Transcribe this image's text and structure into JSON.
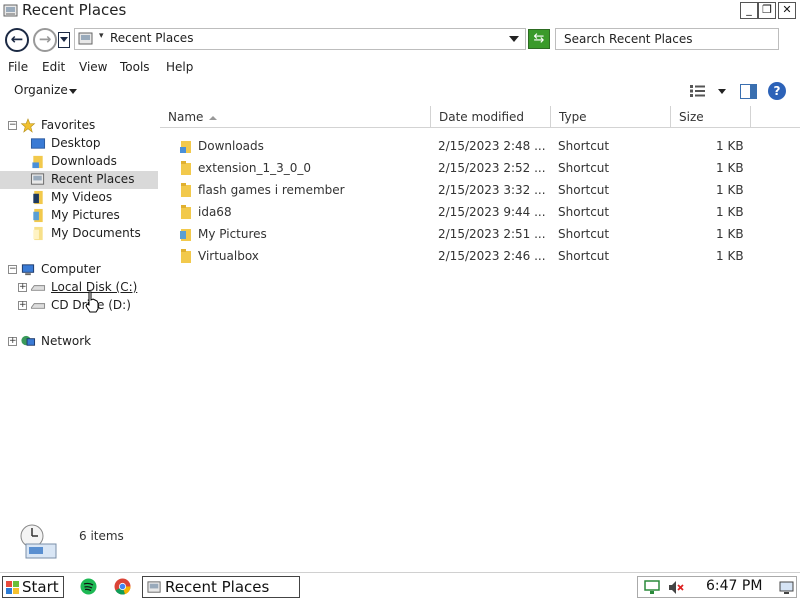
{
  "window": {
    "title": "Recent Places",
    "controls": {
      "minimize": "_",
      "maximize": "❐",
      "close": "✕"
    }
  },
  "address": {
    "separator": "▾",
    "location": "Recent Places",
    "search_placeholder": "Search Recent Places"
  },
  "menu": [
    "File",
    "Edit",
    "View",
    "Tools",
    "Help"
  ],
  "toolbar": {
    "organize": "Organize",
    "help": "?"
  },
  "navigation": {
    "favorites": {
      "label": "Favorites",
      "items": [
        "Desktop",
        "Downloads",
        "Recent Places",
        "My Videos",
        "My Pictures",
        "My Documents"
      ],
      "selected": "Recent Places"
    },
    "computer": {
      "label": "Computer",
      "items": [
        "Local Disk (C:)",
        "CD Drive (D:)"
      ]
    },
    "network": {
      "label": "Network"
    }
  },
  "columns": {
    "name": "Name",
    "date": "Date modified",
    "type": "Type",
    "size": "Size"
  },
  "files": [
    {
      "name": "Downloads",
      "date": "2/15/2023 2:48 ...",
      "type": "Shortcut",
      "size": "1 KB",
      "icon": "downloads-folder-icon"
    },
    {
      "name": "extension_1_3_0_0",
      "date": "2/15/2023 2:52 ...",
      "type": "Shortcut",
      "size": "1 KB",
      "icon": "folder-icon"
    },
    {
      "name": "flash games i remember",
      "date": "2/15/2023 3:32 ...",
      "type": "Shortcut",
      "size": "1 KB",
      "icon": "folder-icon"
    },
    {
      "name": "ida68",
      "date": "2/15/2023 9:44 ...",
      "type": "Shortcut",
      "size": "1 KB",
      "icon": "folder-icon"
    },
    {
      "name": "My Pictures",
      "date": "2/15/2023 2:51 ...",
      "type": "Shortcut",
      "size": "1 KB",
      "icon": "pictures-folder-icon"
    },
    {
      "name": "Virtualbox",
      "date": "2/15/2023 2:46 ...",
      "type": "Shortcut",
      "size": "1 KB",
      "icon": "folder-icon"
    }
  ],
  "status": {
    "item_count": "6 items"
  },
  "taskbar": {
    "start": "Start",
    "task": "Recent Places",
    "clock": "6:47 PM"
  },
  "colors": {
    "selection": "#d9d9d9",
    "folder": "#f2c94c",
    "accent": "#2c62b8",
    "refresh": "#3a9a2a"
  }
}
